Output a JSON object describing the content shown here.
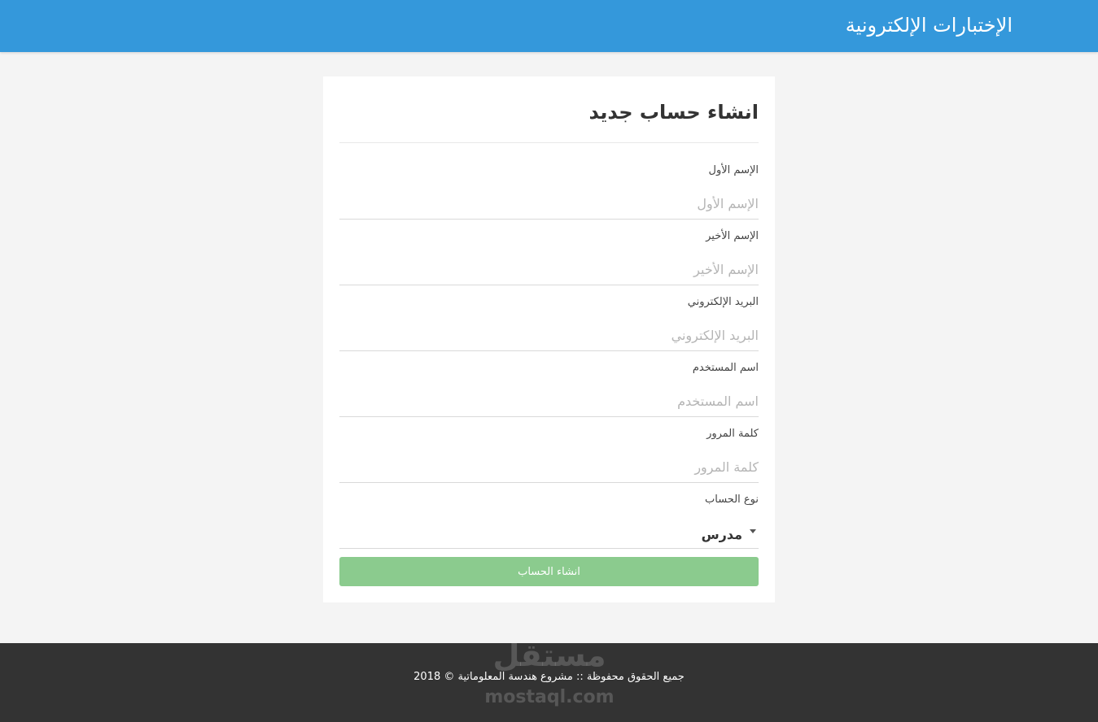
{
  "header": {
    "brand": "الإختبارات الإلكترونية"
  },
  "form": {
    "title": "انشاء حساب جديد",
    "fields": [
      {
        "label": "الإسم الأول",
        "placeholder": "الإسم الأول"
      },
      {
        "label": "الإسم الأخير",
        "placeholder": "الإسم الأخير"
      },
      {
        "label": "البريد الإلكتروني",
        "placeholder": "البريد الإلكتروني"
      },
      {
        "label": "اسم المستخدم",
        "placeholder": "اسم المستخدم"
      },
      {
        "label": "كلمة المرور",
        "placeholder": "كلمة المرور"
      }
    ],
    "account_type": {
      "label": "نوع الحساب",
      "selected": "مدرس"
    },
    "submit_label": "انشاء الحساب"
  },
  "footer": {
    "copyright": "جميع الحقوق محفوظة :: مشروع هندسة المعلوماتية © 2018",
    "watermark_arabic": "مستقل",
    "watermark_latin": "mostaql.com"
  },
  "colors": {
    "header_bg": "#3498db",
    "button_bg": "#8bcb8e",
    "footer_bg": "#333333",
    "page_bg": "#f4f4f4"
  }
}
